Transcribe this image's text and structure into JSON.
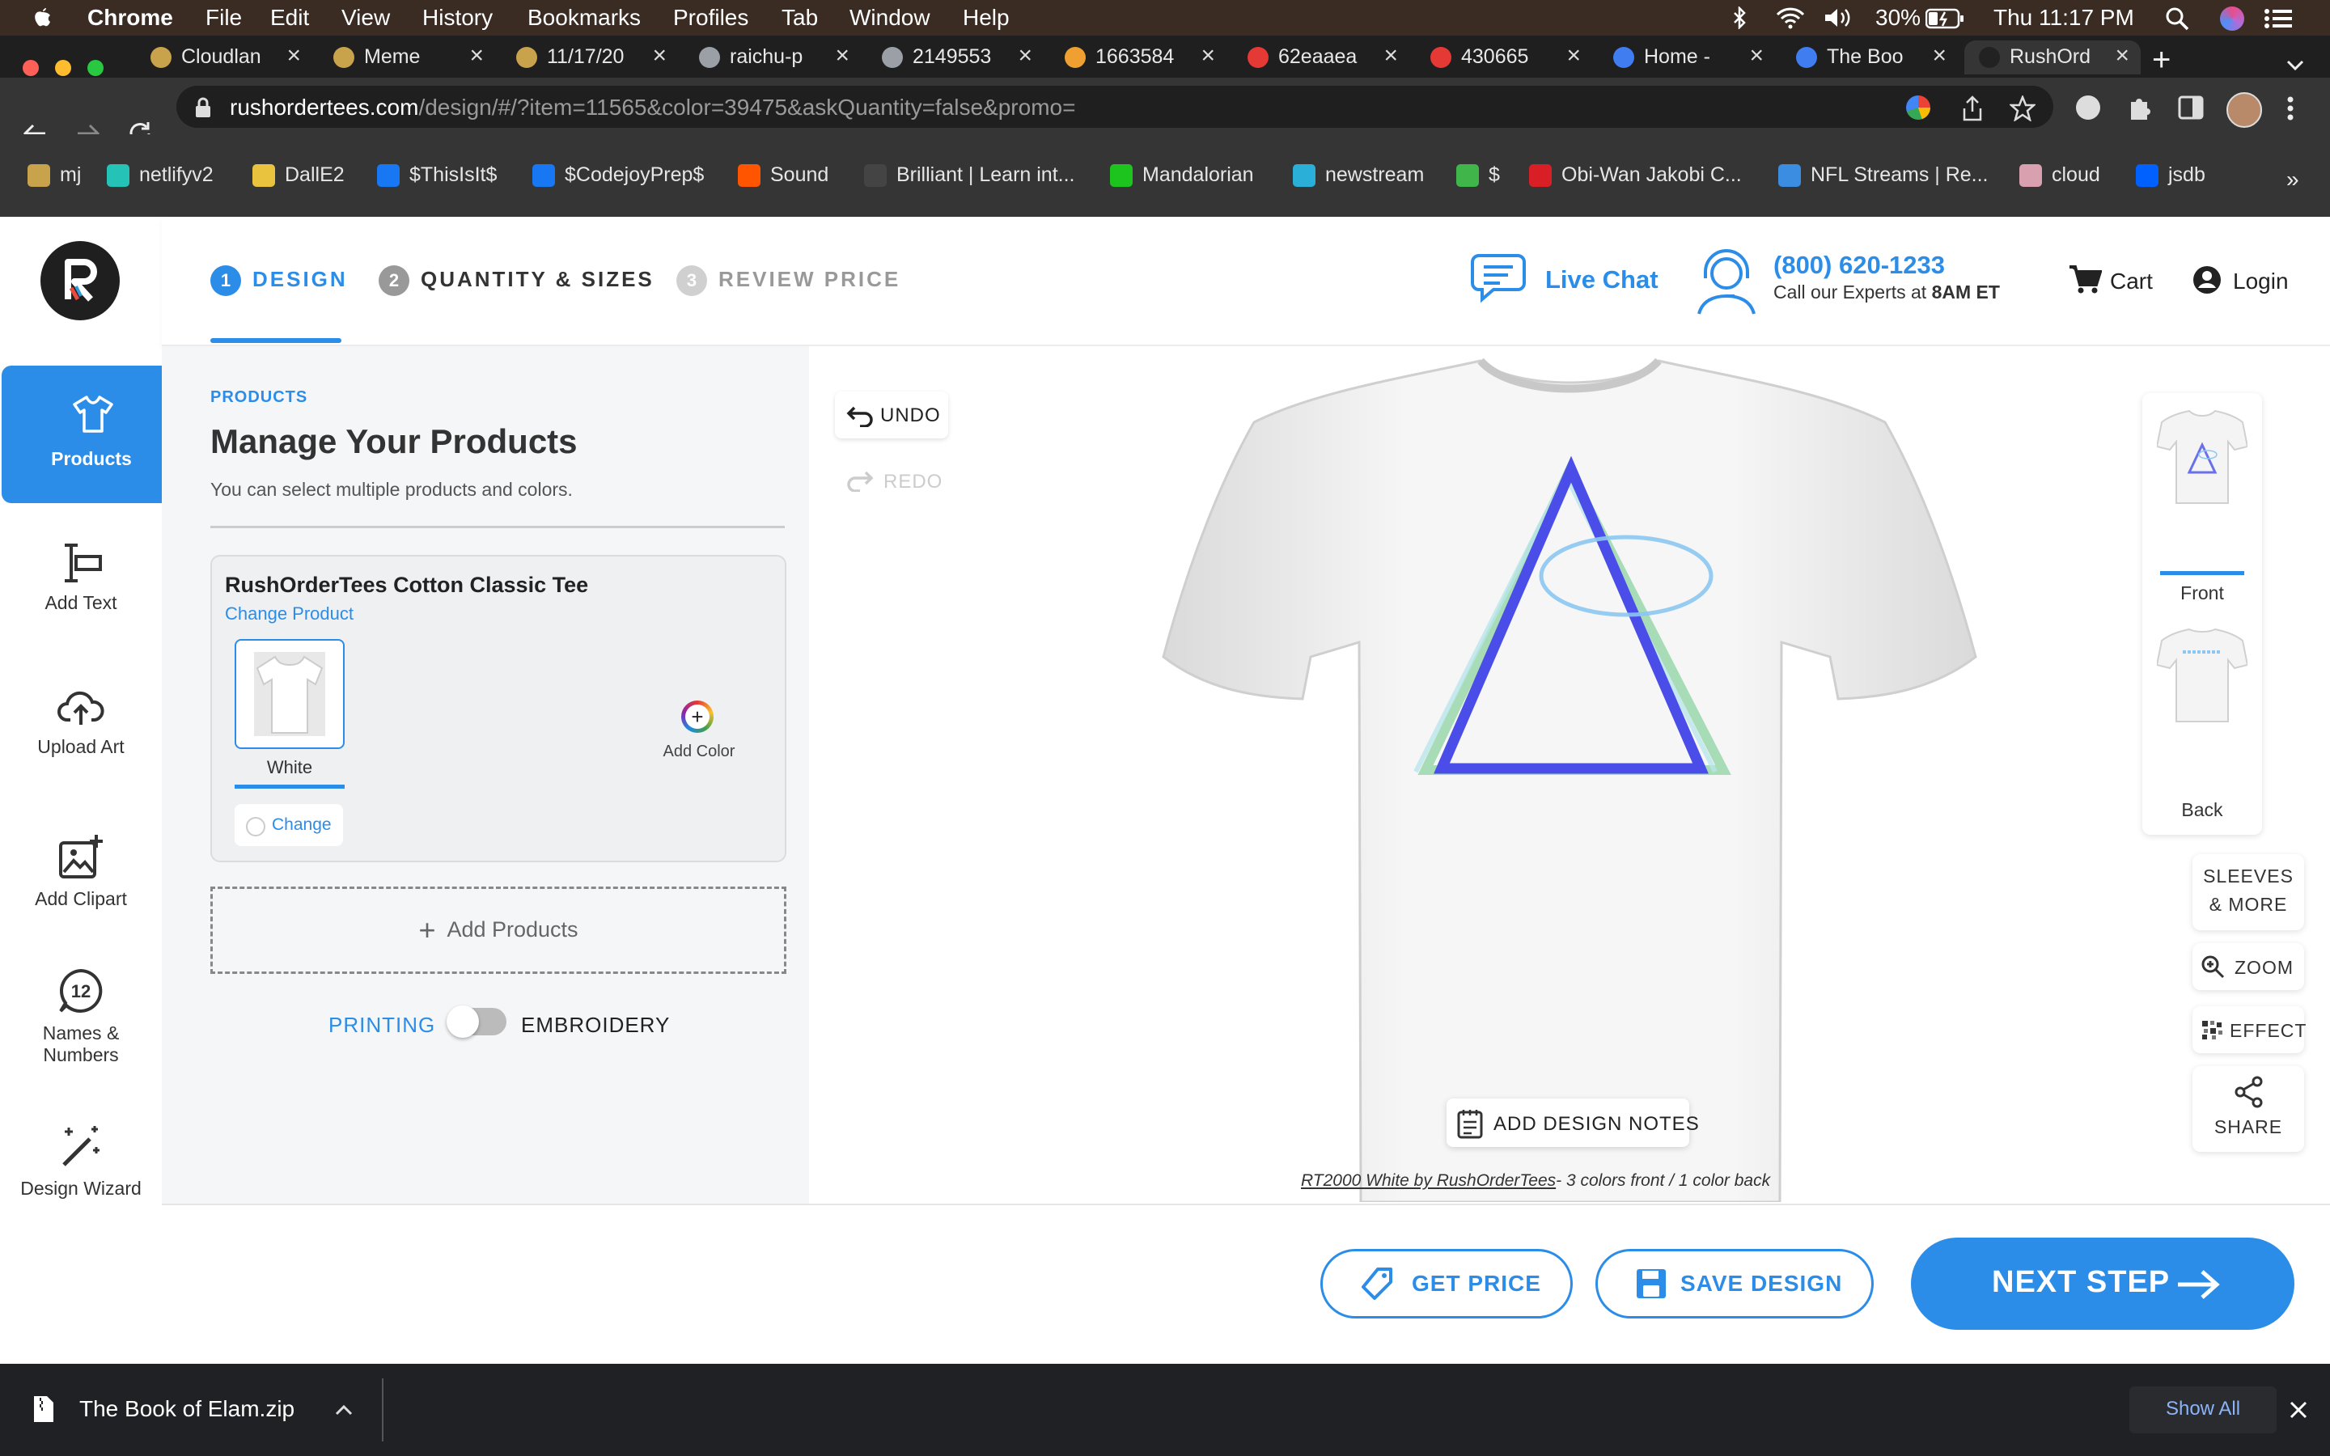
{
  "menubar": {
    "app": "Chrome",
    "menus": [
      "File",
      "Edit",
      "View",
      "History",
      "Bookmarks",
      "Profiles",
      "Tab",
      "Window",
      "Help"
    ],
    "battery": "30%",
    "clock": "Thu 11:17 PM"
  },
  "tabs": [
    {
      "title": "Cloudlan",
      "icon": "triangle-icon",
      "color": "#c9a24c"
    },
    {
      "title": "Meme",
      "icon": "triangle-icon",
      "color": "#c9a24c"
    },
    {
      "title": "11/17/20",
      "icon": "triangle-icon",
      "color": "#c9a24c"
    },
    {
      "title": "raichu-p",
      "icon": "globe-icon",
      "color": "#9aa0a6"
    },
    {
      "title": "2149553",
      "icon": "globe-icon",
      "color": "#9aa0a6"
    },
    {
      "title": "1663584",
      "icon": "thumb-icon",
      "color": "#f0a030"
    },
    {
      "title": "62eaaea",
      "icon": "burst-icon",
      "color": "#e53935"
    },
    {
      "title": "430665",
      "icon": "burst-icon",
      "color": "#e53935"
    },
    {
      "title": "Home -",
      "icon": "c-logo-icon",
      "color": "#3f7df0"
    },
    {
      "title": "The Boo",
      "icon": "c-logo-icon",
      "color": "#3f7df0"
    },
    {
      "title": "RushOrd",
      "icon": "r-logo-icon",
      "color": "#222222",
      "active": true
    }
  ],
  "address": {
    "host": "rushordertees.com",
    "path": "/design/#/?item=11565&color=39475&askQuantity=false&promo="
  },
  "bookmarks": [
    {
      "label": "mj",
      "color": "#c9a24c"
    },
    {
      "label": "netlifyv2",
      "color": "#25c2b8"
    },
    {
      "label": "DallE2",
      "color": "#e9c33d"
    },
    {
      "label": "$ThisIsIt$",
      "color": "#1877f2"
    },
    {
      "label": "$CodejoyPrep$",
      "color": "#1877f2"
    },
    {
      "label": "Sound",
      "color": "#ff5500"
    },
    {
      "label": "Brilliant | Learn int...",
      "color": "#444444"
    },
    {
      "label": "Mandalorian",
      "color": "#1ec41e"
    },
    {
      "label": "newstream",
      "color": "#2ab0d8"
    },
    {
      "label": "$",
      "color": "#3fb54a"
    },
    {
      "label": "Obi-Wan Jakobi C...",
      "color": "#d81f26"
    },
    {
      "label": "NFL Streams | Re...",
      "color": "#3a8de0"
    },
    {
      "label": "cloud",
      "color": "#d9a0b0"
    },
    {
      "label": "jsdb",
      "color": "#0061fe"
    }
  ],
  "steps": [
    {
      "num": "1",
      "label": "DESIGN"
    },
    {
      "num": "2",
      "label": "QUANTITY & SIZES"
    },
    {
      "num": "3",
      "label": "REVIEW PRICE"
    }
  ],
  "header": {
    "live_chat": "Live Chat",
    "phone": "(800) 620-1233",
    "experts_prefix": "Call our Experts at ",
    "experts_time": "8AM ET",
    "cart": "Cart",
    "login": "Login"
  },
  "sidebar": {
    "items": [
      "Products",
      "Add Text",
      "Upload Art",
      "Add Clipart",
      "Names &",
      "Numbers",
      "Design Wizard"
    ]
  },
  "panel": {
    "section": "PRODUCTS",
    "title": "Manage Your Products",
    "subtitle": "You can select multiple products and colors.",
    "product_name": "RushOrderTees Cotton Classic Tee",
    "change_product": "Change Product",
    "color_name": "White",
    "change": "Change",
    "add_color": "Add Color",
    "add_products": "Add Products",
    "printing": "PRINTING",
    "embroidery": "EMBROIDERY"
  },
  "canvas": {
    "undo": "UNDO",
    "redo": "REDO",
    "add_notes": "ADD DESIGN NOTES",
    "caption_link": "RT2000 White by RushOrderTees",
    "caption_rest": "- 3 colors front  /  1 color back",
    "front": "Front",
    "back": "Back",
    "sleeves_1": "SLEEVES",
    "sleeves_2": "& MORE",
    "zoom": "ZOOM",
    "effect": "EFFECT",
    "share": "SHARE"
  },
  "footer": {
    "get_price": "GET PRICE",
    "save_design": "SAVE DESIGN",
    "next_step": "NEXT STEP"
  },
  "download": {
    "file": "The Book of Elam.zip",
    "show_all": "Show All"
  },
  "colors": {
    "accent": "#2c8de8",
    "triangle_blue": "#4a4de8",
    "triangle_green": "#9fd9b0",
    "ellipse": "#8cc7f2"
  }
}
